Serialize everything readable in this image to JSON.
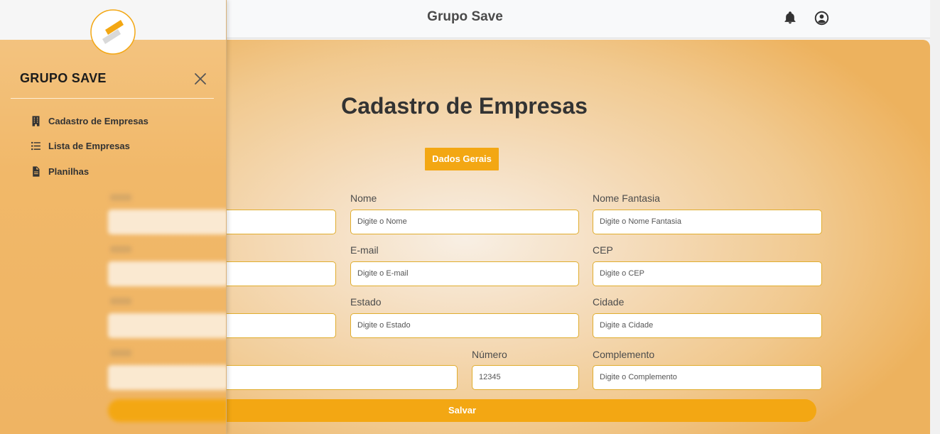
{
  "header": {
    "title": "Grupo Save"
  },
  "drawer": {
    "brand": "GRUPO SAVE",
    "items": [
      {
        "label": "Cadastro de Empresas",
        "icon": "building-icon"
      },
      {
        "label": "Lista de Empresas",
        "icon": "list-icon"
      },
      {
        "label": "Planilhas",
        "icon": "file-icon"
      }
    ]
  },
  "form": {
    "title": "Cadastro de Empresas",
    "tab_label": "Dados Gerais",
    "fields": {
      "nome": {
        "label": "Nome",
        "placeholder": "Digite o Nome"
      },
      "nome_fantasia": {
        "label": "Nome Fantasia",
        "placeholder": "Digite o Nome Fantasia"
      },
      "email": {
        "label": "E-mail",
        "placeholder": "Digite o E-mail"
      },
      "cep": {
        "label": "CEP",
        "placeholder": "Digite o CEP"
      },
      "estado": {
        "label": "Estado",
        "placeholder": "Digite o Estado"
      },
      "cidade": {
        "label": "Cidade",
        "placeholder": "Digite a Cidade"
      },
      "numero": {
        "label": "Número",
        "placeholder": "12345"
      },
      "complemento": {
        "label": "Complemento",
        "placeholder": "Digite o Complemento"
      }
    },
    "save_label": "Salvar"
  },
  "colors": {
    "accent": "#f3a713",
    "border": "#e0ad2e"
  }
}
